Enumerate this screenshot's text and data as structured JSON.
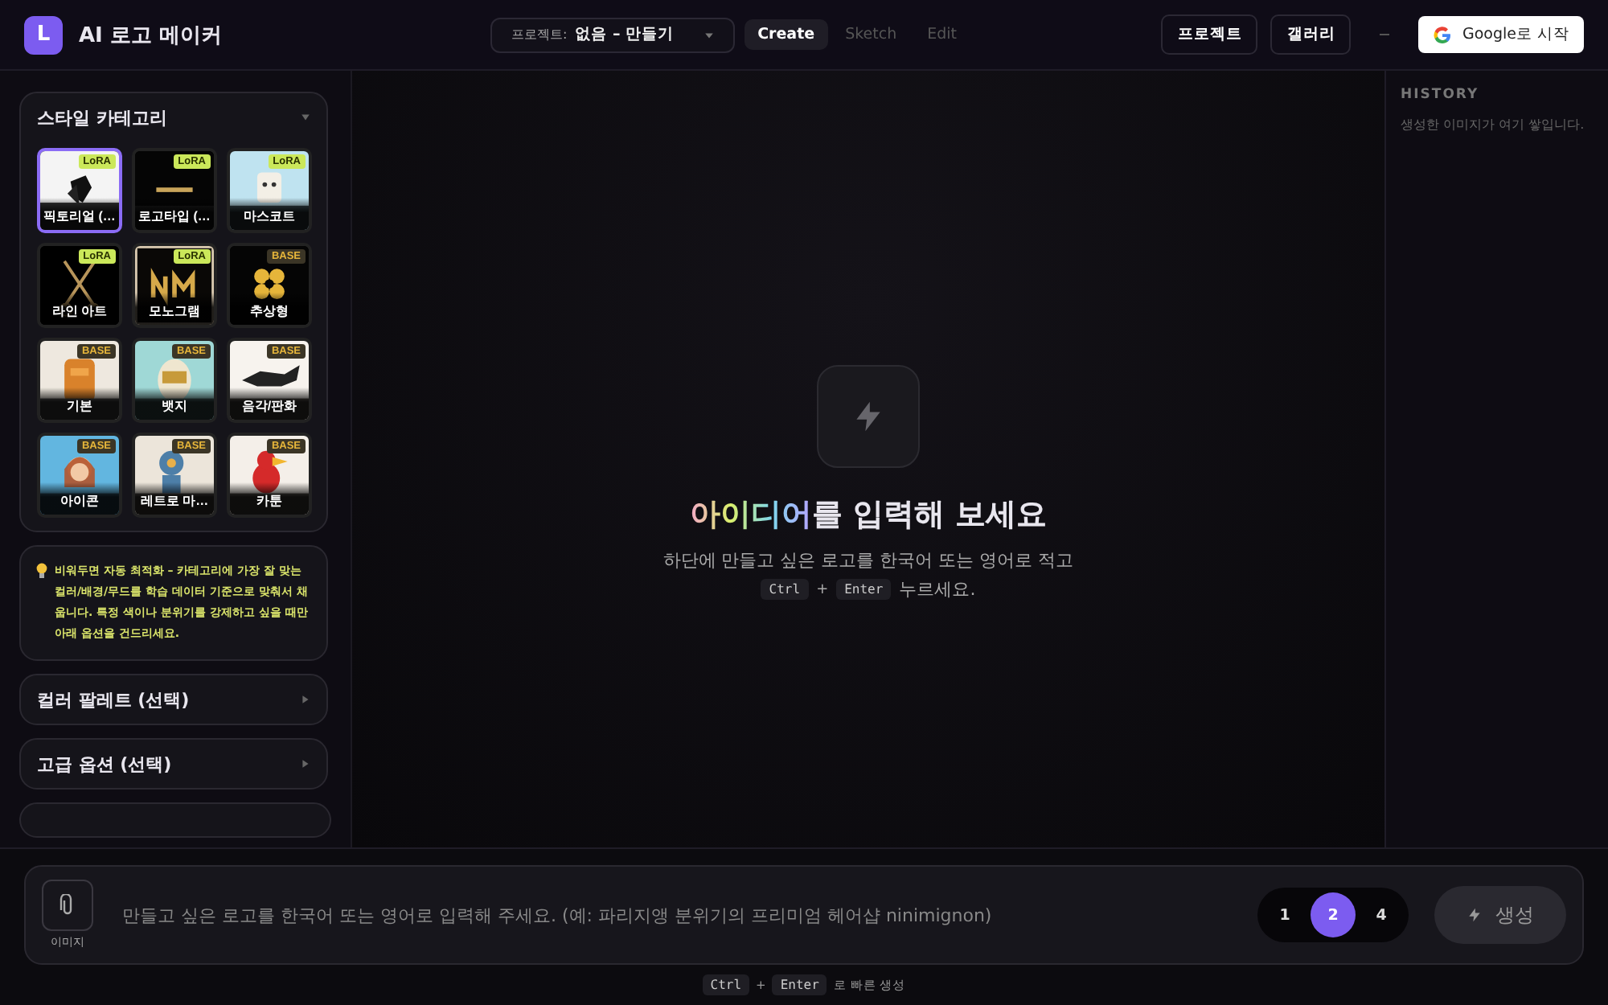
{
  "header": {
    "logo_letter": "L",
    "title": "AI 로고 메이커",
    "project_select": {
      "label": "프로젝트:",
      "value": "없음 – 만들기"
    },
    "modes": [
      {
        "label": "Create",
        "selected": true
      },
      {
        "label": "Sketch",
        "selected": false
      },
      {
        "label": "Edit",
        "selected": false
      }
    ],
    "buttons": [
      "프로젝트",
      "갤러리"
    ],
    "login_button": "Google로 시작"
  },
  "sidebar": {
    "style_panel": {
      "title": "스타일 카테고리",
      "expanded": true,
      "styles": [
        {
          "label": "픽토리얼 (…",
          "kind": "lora",
          "badge": "LoRA",
          "selected": true
        },
        {
          "label": "로고타입 (…",
          "kind": "lora",
          "badge": "LoRA",
          "selected": false
        },
        {
          "label": "마스코트",
          "kind": "lora",
          "badge": "LoRA",
          "selected": false
        },
        {
          "label": "라인 아트",
          "kind": "lora",
          "badge": "LoRA",
          "selected": false
        },
        {
          "label": "모노그램",
          "kind": "lora",
          "badge": "LoRA",
          "selected": false
        },
        {
          "label": "추상형",
          "kind": "base",
          "badge": "BASE",
          "selected": false
        },
        {
          "label": "기본",
          "kind": "base",
          "badge": "BASE",
          "selected": false
        },
        {
          "label": "뱃지",
          "kind": "base",
          "badge": "BASE",
          "selected": false
        },
        {
          "label": "음각/판화",
          "kind": "base",
          "badge": "BASE",
          "selected": false
        },
        {
          "label": "아이콘",
          "kind": "base",
          "badge": "BASE",
          "selected": false
        },
        {
          "label": "레트로 마…",
          "kind": "base",
          "badge": "BASE",
          "selected": false
        },
        {
          "label": "카툰",
          "kind": "base",
          "badge": "BASE",
          "selected": false
        }
      ]
    },
    "tip": "비워두면 자동 최적화 – 카테고리에 가장 잘 맞는 컬러/배경/무드를 학습 데이터 기준으로 맞춰서 채웁니다. 특정 색이나 분위기를 강제하고 싶을 때만 아래 옵션을 건드리세요.",
    "sections": [
      {
        "title": "컬러 팔레트 (선택)",
        "expanded": false
      },
      {
        "title": "고급 옵션 (선택)",
        "expanded": false
      }
    ]
  },
  "main": {
    "title_highlight": "아이디어",
    "title_rest": "를 입력해 보세요",
    "subtitle": "하단에 만들고 싶은 로고를 한국어 또는 영어로 적고",
    "keys": [
      "Ctrl",
      "+",
      "Enter"
    ],
    "subtitle_end": "누르세요."
  },
  "history": {
    "title": "HISTORY",
    "empty_text": "생성한 이미지가 여기 쌓입니다."
  },
  "composer": {
    "attach_label": "이미지",
    "placeholder": "만들고 싶은 로고를 한국어 또는 영어로 입력해 주세요. (예: 파리지앵 분위기의 프리미엄 헤어샵 ninimignon)",
    "counts": [
      {
        "label": "1",
        "selected": false
      },
      {
        "label": "2",
        "selected": true
      },
      {
        "label": "4",
        "selected": false
      }
    ],
    "generate": {
      "label": "생성",
      "disabled": true
    },
    "hint_keys": [
      "Ctrl",
      "+",
      "Enter"
    ],
    "hint_text": "로 빠른 생성"
  }
}
